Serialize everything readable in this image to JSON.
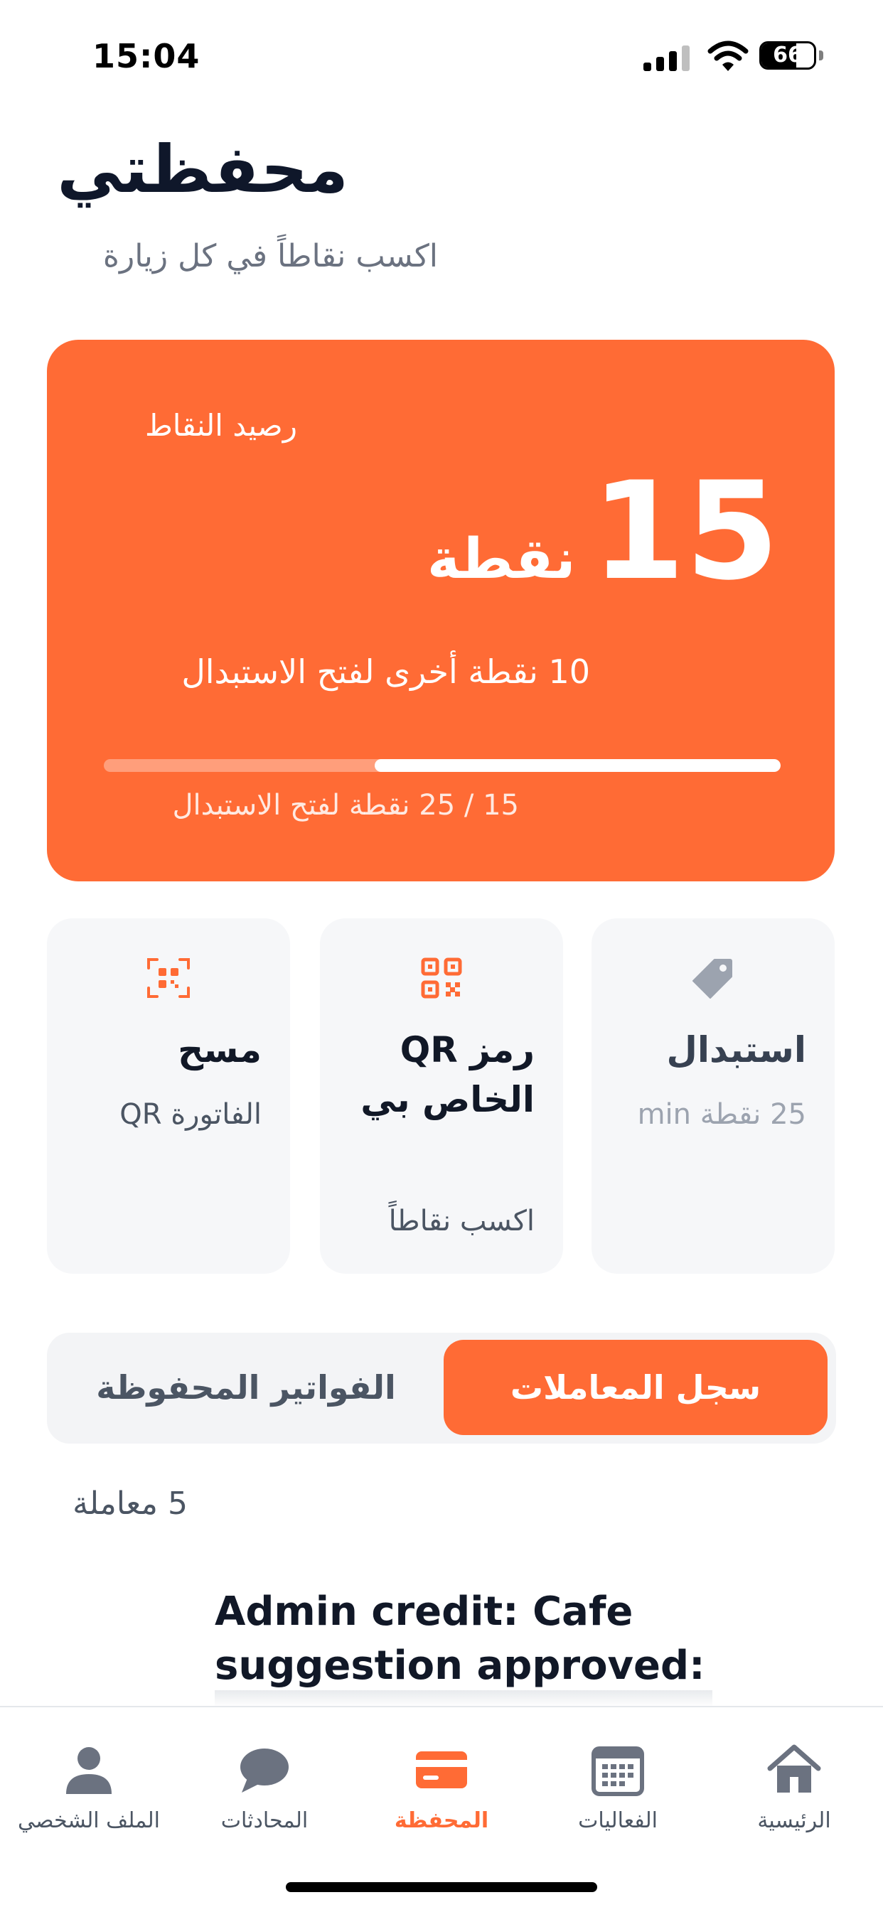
{
  "status_bar": {
    "time": "15:04",
    "battery_level": "66",
    "battery_percent": 66
  },
  "header": {
    "title": "محفظتي",
    "subtitle": "اكسب نقاطاً في كل زيارة"
  },
  "points_card": {
    "label": "رصيد النقاط",
    "points": "15",
    "unit": "نقطة",
    "remaining_text": "10 نقطة أخرى لفتح الاستبدال",
    "progress_caption": "15 / 25 نقطة لفتح الاستبدال",
    "progress_fraction": 0.6,
    "accent_color": "#ff6b35"
  },
  "actions": {
    "scan": {
      "title": "مسح",
      "subtitle": "الفاتورة QR",
      "icon": "scan-qr-icon"
    },
    "my_qr": {
      "title": "رمز QR الخاص بي",
      "subtitle": "اكسب نقاطاً",
      "icon": "qr-code-icon"
    },
    "redeem": {
      "title": "استبدال",
      "subtitle": "25 نقطة min",
      "icon": "tag-icon"
    }
  },
  "tabs": {
    "transactions": "سجل المعاملات",
    "saved_invoices": "الفواتير المحفوظة",
    "active": "transactions"
  },
  "transactions": {
    "count_label": "5 معاملة",
    "items": [
      {
        "title": "Admin credit: Cafe suggestion approved:"
      }
    ]
  },
  "bottom_nav": {
    "profile": "الملف الشخصي",
    "chats": "المحادثات",
    "wallet": "المحفظة",
    "events": "الفعاليات",
    "home": "الرئيسية",
    "active": "wallet"
  }
}
